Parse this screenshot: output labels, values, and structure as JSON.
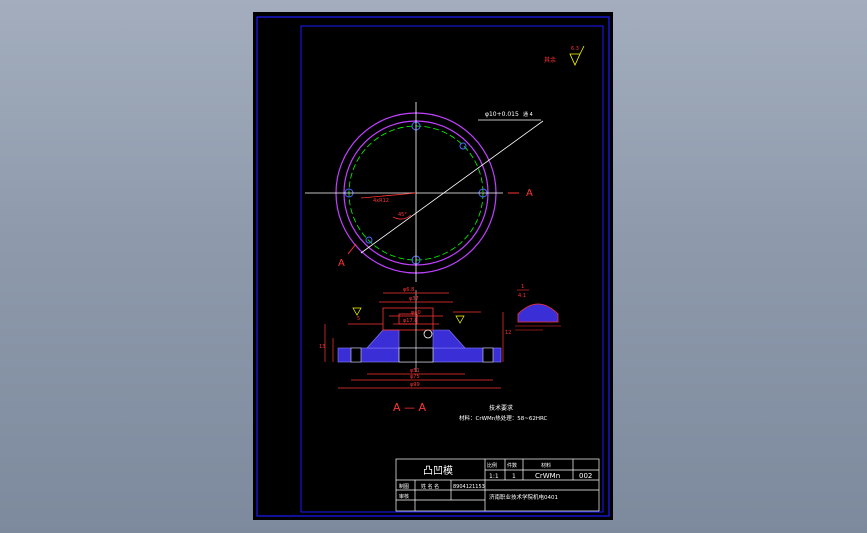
{
  "drawing": {
    "roughness_label": "其余",
    "roughness_value": "6.3",
    "hole_callout": "φ10+0.015",
    "hole_callout_tail": "通 4",
    "bolt_circle_label": "4xR12",
    "angle_label": "45°",
    "section_marker": "A",
    "section_title": "A — A",
    "detail_label_num": "1",
    "detail_label_den": "4:1",
    "tech_title": "技术要求",
    "tech_line": "材料：CrWMn热处理：58~62HRC",
    "title_block": {
      "part_name": "凸凹模",
      "header_cols": [
        "比例",
        "件数",
        "材料"
      ],
      "scale": "1:1",
      "qty": "1",
      "material": "CrWMn",
      "drawing_no": "002",
      "designer_label": "制图",
      "checker_label": "审核",
      "designer_name": "姓 名 名",
      "drawing_code": "8904121153",
      "school": "济南职业技术学院机电0401"
    },
    "dims": [
      "φ6.8",
      "φ37",
      "φ40",
      "φ17.8",
      "φ51",
      "φ75",
      "φ99",
      "13",
      "12",
      "5"
    ]
  }
}
